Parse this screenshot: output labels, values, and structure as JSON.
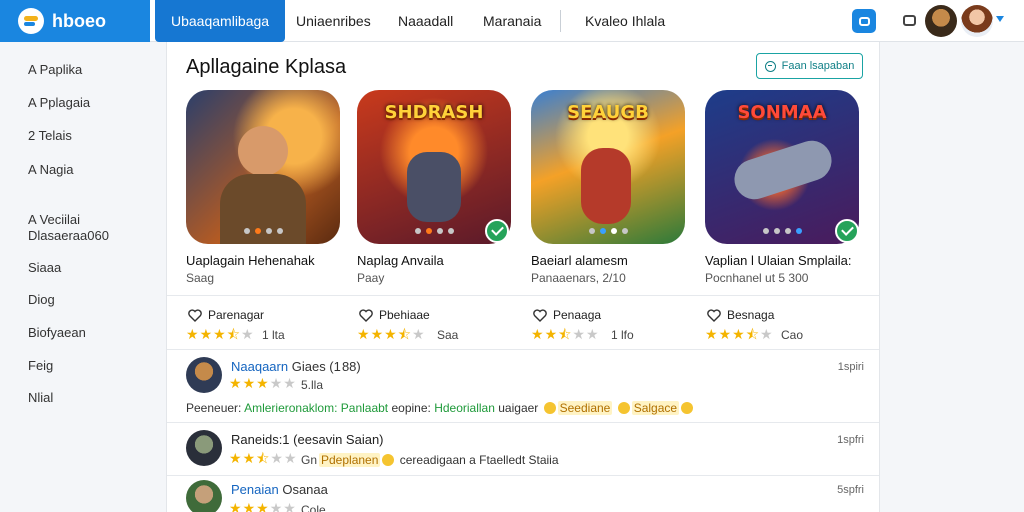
{
  "brand": {
    "name": "hboeo"
  },
  "nav": {
    "tabs": [
      {
        "label": "Ubaaqamlibaga",
        "active": true
      },
      {
        "label": "Uniaenribes"
      },
      {
        "label": "Naaadall"
      },
      {
        "label": "Maranaia"
      },
      {
        "label": "Kvaleo Ihlala"
      }
    ]
  },
  "sidebar": {
    "items": [
      "A Paplika",
      "A Pplagaia",
      "2 Telais",
      "A Nagia",
      "A Veciilai Dlasaeraa060",
      "Siaaa",
      "Diog",
      "Biofyaean",
      "Feig",
      "Nlial"
    ]
  },
  "main": {
    "title": "Apllagaine Kplasa",
    "view_button": "Faan lsapaban"
  },
  "cards": [
    {
      "name": "Uaplagain Hehenahak",
      "sub": "Saag",
      "logo": "",
      "art": "#b55b22",
      "art2": "#2b3f6b",
      "dots": [
        false,
        true,
        false,
        false
      ],
      "verified": false
    },
    {
      "name": "Naplag Anvaila",
      "sub": "Paay",
      "logo": "SHDRASH",
      "art": "#c93a1c",
      "art2": "#5a1a2a",
      "dots": [
        false,
        true,
        false,
        false
      ],
      "verified": true
    },
    {
      "name": "Baeiarl alamesm",
      "sub": "Panaaenars, 2/10",
      "logo": "SEAUGB",
      "art": "#f4a127",
      "art2": "#2c7a3a",
      "dots": [
        false,
        true,
        true,
        false
      ],
      "verified": false
    },
    {
      "name": "Vaplian l Ulaian Smplaila:",
      "sub": "Pocnhanel ut 5 300",
      "logo": "SONMAA",
      "art": "#1d3d8a",
      "art2": "#4a1b5c",
      "dots": [
        false,
        false,
        false,
        true
      ],
      "verified": true
    }
  ],
  "ratings": [
    {
      "label": "Parenagar",
      "stars": 3.5,
      "count": "1 lta"
    },
    {
      "label": "Pbehiaae",
      "stars": 3.5,
      "count": "Saa"
    },
    {
      "label": "Penaaga",
      "stars": 2.5,
      "count": "1 lfo"
    },
    {
      "label": "Besnaga",
      "stars": 3.5,
      "count": "Cao"
    }
  ],
  "reviews": [
    {
      "name": "Naaqaarn",
      "name_extra": "Giaes (1 88)",
      "time": "1spiri",
      "stars": 3,
      "count": "5.lla",
      "line_prefix": "Peeneuer:",
      "line_green1": "Amlerieronaklom: Panlaabt",
      "line_mid": "eopine:",
      "line_green2": "Hdeoriallan",
      "line_mid2": "uaigaer",
      "tag1": "Seediane",
      "tag2": "Salgace"
    },
    {
      "name": "Raneids:1",
      "name_extra": "(eesavin Saian)",
      "time": "1spfri",
      "stars": 2.5,
      "count": "Gn",
      "tag1": "Pdeplanen",
      "line_tail": "cereadigaan a Ftaelledt Staiia"
    },
    {
      "name": "Penaian",
      "name_extra": "Osanaa",
      "time": "5spfri",
      "stars": 3,
      "count": "Cole"
    }
  ],
  "colors": {
    "brand": "#1a86e0",
    "accent": "#0f7f86",
    "star": "#f4b400",
    "verified": "#25a35a"
  }
}
